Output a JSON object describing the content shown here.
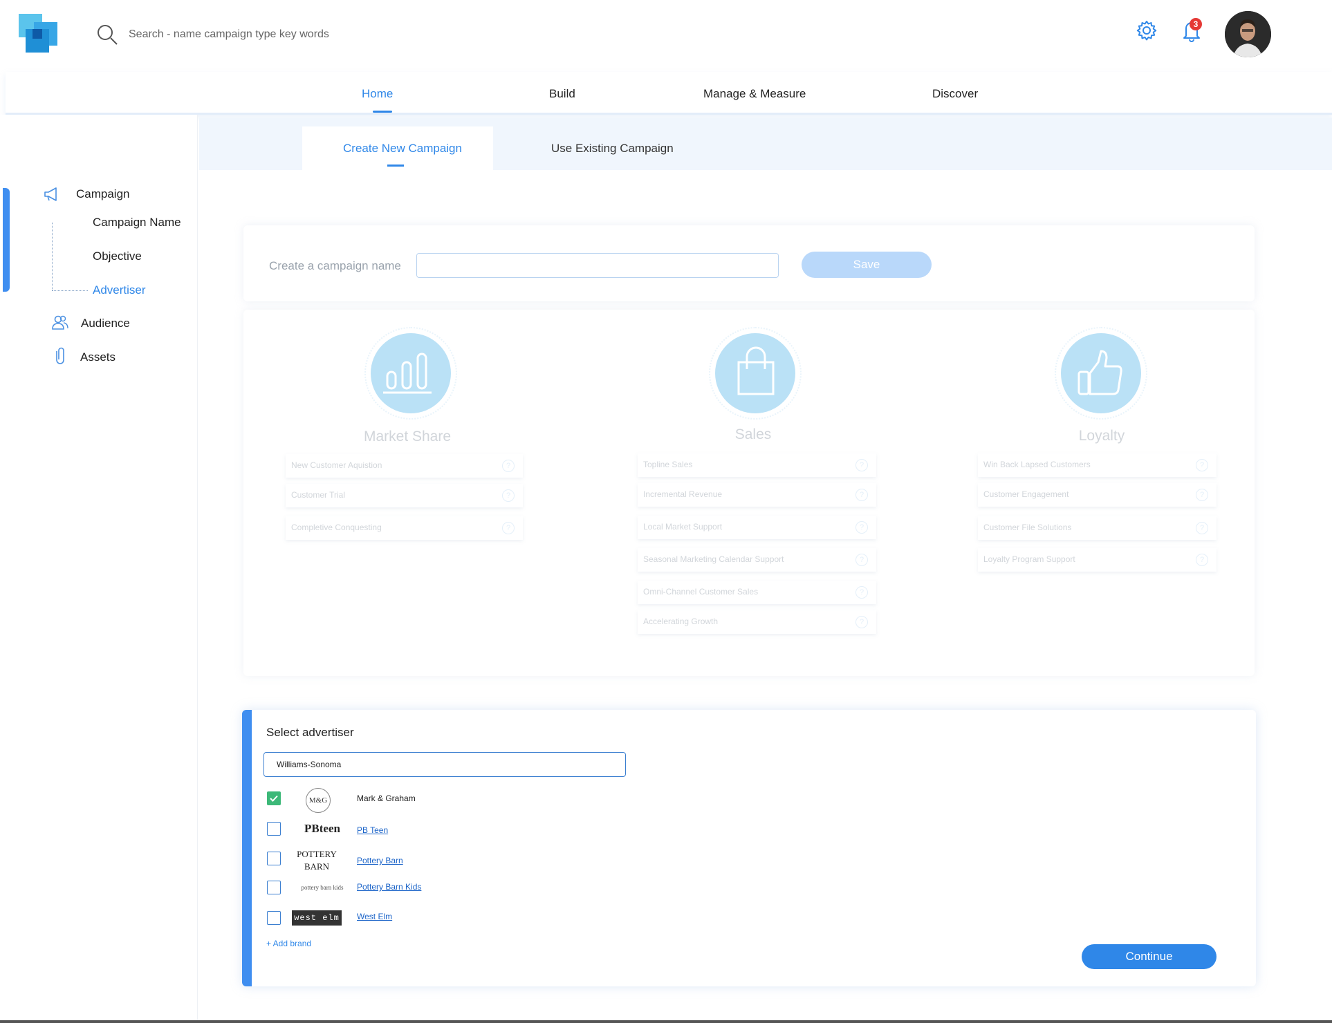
{
  "header": {
    "search_placeholder": "Search - name campaign type key words",
    "notification_count": "3"
  },
  "nav": {
    "items": [
      {
        "label": "Home",
        "active": true
      },
      {
        "label": "Build"
      },
      {
        "label": "Manage & Measure"
      },
      {
        "label": "Discover"
      }
    ]
  },
  "sidebar": {
    "campaign": "Campaign",
    "sub_items": [
      "Campaign Name",
      "Objective",
      "Advertiser"
    ],
    "audience": "Audience",
    "assets": "Assets"
  },
  "tabs": {
    "create": "Create New Campaign",
    "existing": "Use Existing Campaign"
  },
  "campaign_name": {
    "label": "Create a campaign name",
    "value": "",
    "save_label": "Save"
  },
  "objectives": [
    {
      "title": "Market Share",
      "icon": "bar-chart-icon",
      "goals": [
        "New Customer Aquistion",
        "Customer Trial",
        "Completive Conquesting"
      ]
    },
    {
      "title": "Sales",
      "icon": "shopping-bag-icon",
      "goals": [
        "Topline Sales",
        "Incremental Revenue",
        "Local Market Support",
        "Seasonal Marketing Calendar Support",
        "Omni-Channel Customer Sales",
        "Accelerating Growth"
      ]
    },
    {
      "title": "Loyalty",
      "icon": "thumbs-up-icon",
      "goals": [
        "Win Back Lapsed Customers",
        "Customer Engagement",
        "Customer File Solutions",
        "Loyalty Program Support"
      ]
    }
  ],
  "advertiser": {
    "title": "Select advertiser",
    "search_value": "Williams-Sonoma",
    "brands": [
      {
        "logo": "M&G",
        "name": "Mark & Graham",
        "checked": true
      },
      {
        "logo": "PBteen",
        "name": "PB Teen",
        "checked": false
      },
      {
        "logo": "POTTERY BARN",
        "name": "Pottery Barn",
        "checked": false
      },
      {
        "logo": "pottery barn kids",
        "name": "Pottery Barn Kids",
        "checked": false
      },
      {
        "logo": "west elm",
        "name": "West Elm",
        "checked": false
      }
    ],
    "add_brand_label": "+ Add brand",
    "continue_label": "Continue"
  },
  "colors": {
    "accent": "#2f87e8",
    "objective_circle": "#54b5e8",
    "check_on": "#3cb878",
    "badge": "#e53935"
  }
}
